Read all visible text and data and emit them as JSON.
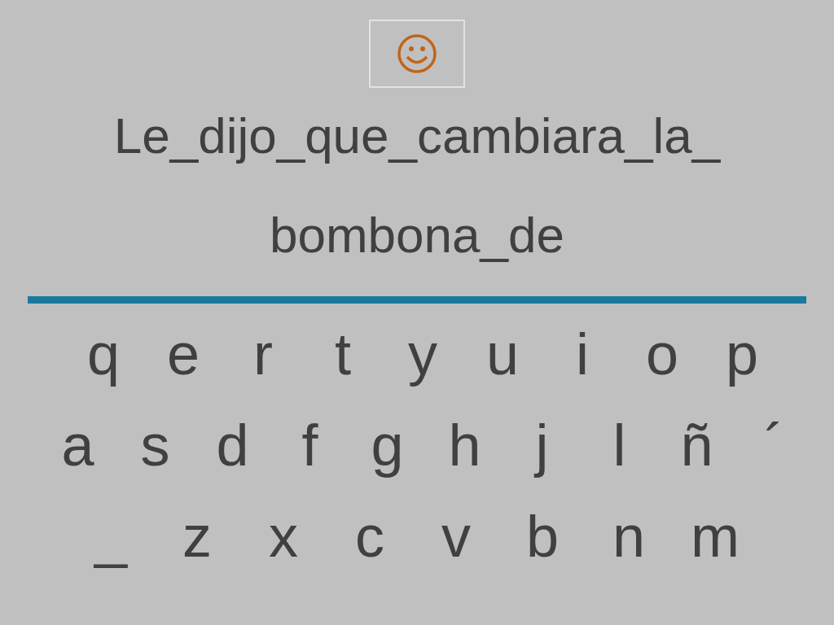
{
  "sentence": {
    "lines": [
      "Le_dijo_que_cambiara_la_",
      "bombona_de"
    ]
  },
  "keyboard": {
    "rows": [
      [
        "q",
        "e",
        "r",
        "t",
        "y",
        "u",
        "i",
        "o",
        "p"
      ],
      [
        "a",
        "s",
        "d",
        "f",
        "g",
        "h",
        "j",
        "l",
        "ñ",
        "´"
      ],
      [
        "_",
        "z",
        "x",
        "c",
        "v",
        "b",
        "n",
        "m"
      ]
    ]
  }
}
